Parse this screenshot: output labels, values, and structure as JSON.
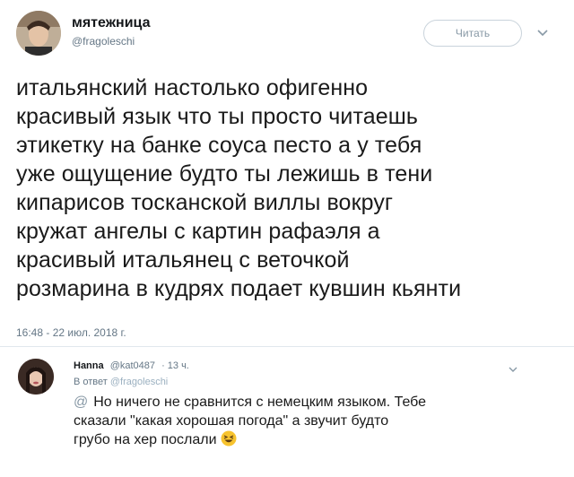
{
  "tweet": {
    "display_name": "мятежница",
    "handle": "@fragoleschi",
    "follow_label": "Читать",
    "text_lines": [
      "итальянский настолько офигенно",
      "красивый язык что ты просто читаешь",
      "этикетку на банке соуса песто а у тебя",
      "уже ощущение будто ты лежишь в тени",
      "кипарисов тосканской виллы вокруг",
      "кружат ангелы с картин рафаэля а",
      "красивый итальянец с веточкой",
      "розмарина в кудрях подает кувшин кьянти"
    ],
    "timestamp": "16:48 - 22 июл. 2018 г.",
    "menu_icon": "chevron-down-icon"
  },
  "reply": {
    "name": "Hanna",
    "handle": "@kat0487",
    "time": "· 13 ч.",
    "reply_to_prefix": "В ответ",
    "reply_to_handle": "@fragoleschi",
    "at_icon": "@",
    "text_lines": [
      "Но ничего не сравнится с немецким языком. Тебе",
      "сказали \"какая хорошая погода\" а звучит будто",
      "грубо на хер послали"
    ],
    "emoji_icon": "laughing-face-icon",
    "menu_icon": "chevron-down-icon"
  },
  "colors": {
    "text": "#1a1a1a",
    "secondary": "#657786",
    "border": "#e1e8ed",
    "emoji": "#f7c32e"
  }
}
